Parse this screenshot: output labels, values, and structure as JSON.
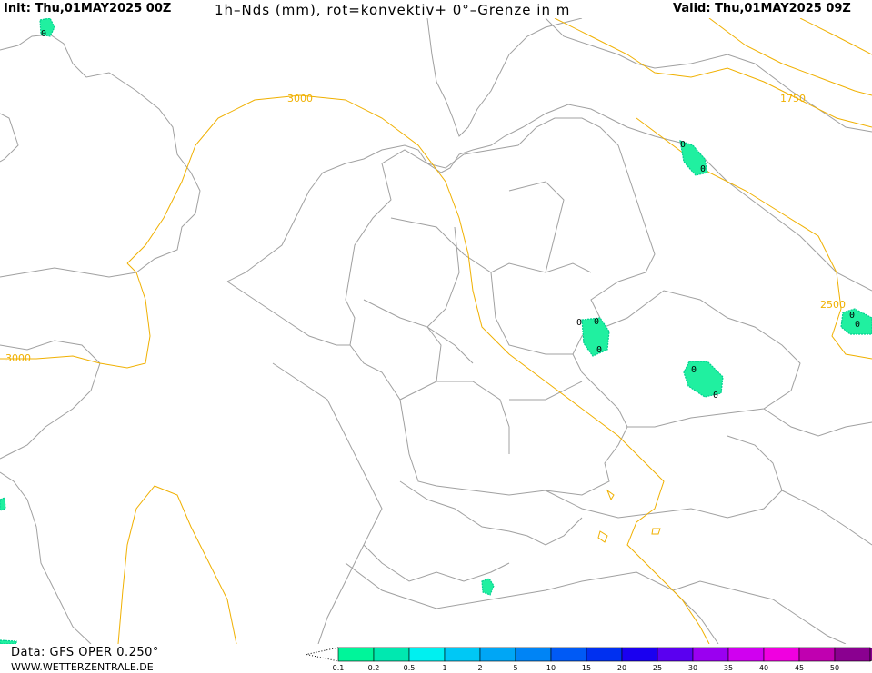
{
  "header": {
    "init": "Init: Thu,01MAY2025 00Z",
    "title": "1h–Nds (mm), rot=konvektiv+ 0°–Grenze in m",
    "valid": "Valid: Thu,01MAY2025 09Z"
  },
  "footer": {
    "data_source": "Data: GFS OPER 0.250°",
    "website": "WWW.WETTERZENTRALE.DE"
  },
  "contours": {
    "labels": [
      "3000",
      "3000",
      "1750",
      "2500"
    ],
    "color": "#f0b000"
  },
  "precip_markers": {
    "label": "0",
    "count": 10
  },
  "legend": {
    "items": [
      {
        "label": "0.1",
        "color": "#00f59a"
      },
      {
        "label": "0.2",
        "color": "#00e8b0"
      },
      {
        "label": "0.5",
        "color": "#00f0f0"
      },
      {
        "label": "1",
        "color": "#00c8f5"
      },
      {
        "label": "2",
        "color": "#00a6f5"
      },
      {
        "label": "5",
        "color": "#0084f5"
      },
      {
        "label": "10",
        "color": "#005af5"
      },
      {
        "label": "15",
        "color": "#0030f0"
      },
      {
        "label": "20",
        "color": "#1a00f0"
      },
      {
        "label": "25",
        "color": "#5a00f0"
      },
      {
        "label": "30",
        "color": "#9a00f0"
      },
      {
        "label": "35",
        "color": "#d000f0"
      },
      {
        "label": "40",
        "color": "#f000e0"
      },
      {
        "label": "45",
        "color": "#c000b0"
      },
      {
        "label": "50",
        "color": "#8a0090"
      }
    ]
  },
  "colors": {
    "border": "#999999",
    "precip": "#20f0a0",
    "precip_edge": "#00d090"
  }
}
